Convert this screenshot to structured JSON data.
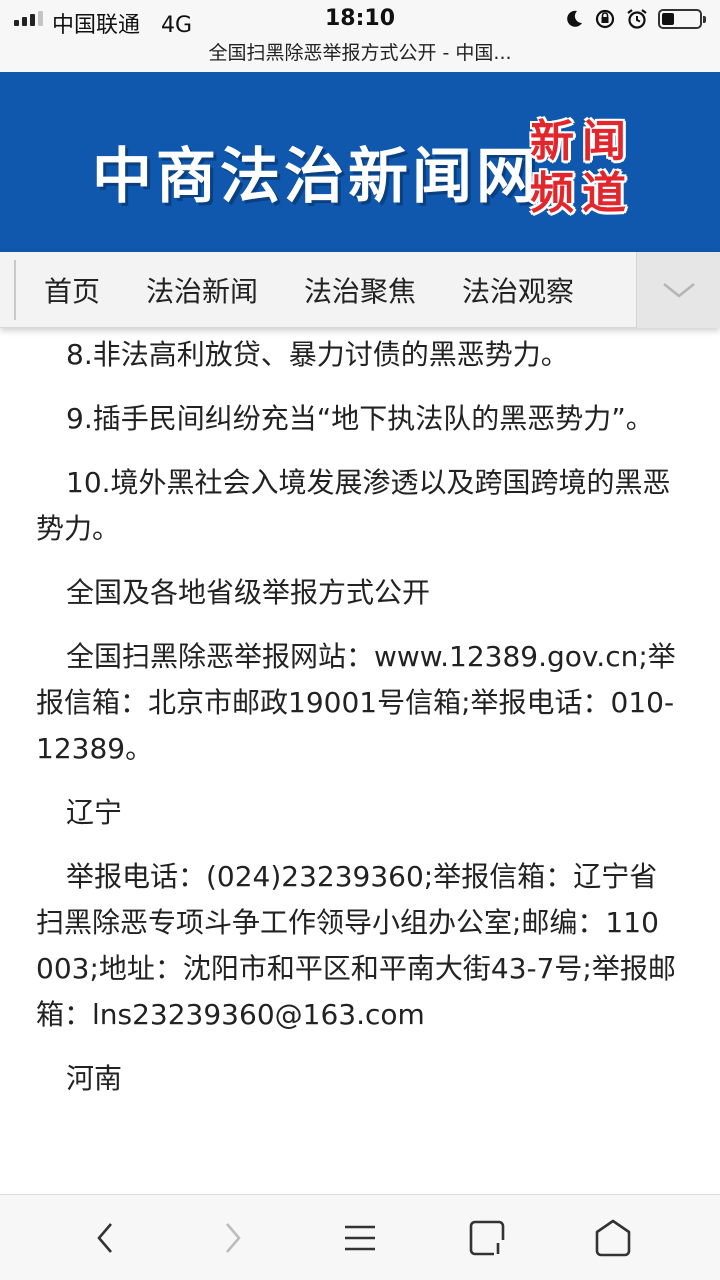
{
  "status_bar": {
    "carrier": "中国联通",
    "network": "4G",
    "time": "18:10"
  },
  "browser": {
    "page_title": "全国扫黑除恶举报方式公开 - 中国..."
  },
  "site": {
    "name": "中商法治新闻网",
    "seal_chars": [
      "新",
      "闻",
      "频",
      "道"
    ],
    "brand_color": "#0f58ad"
  },
  "nav": {
    "items": [
      {
        "label": "首页"
      },
      {
        "label": "法治新闻"
      },
      {
        "label": "法治聚焦"
      },
      {
        "label": "法治观察"
      }
    ]
  },
  "article": {
    "paragraphs": [
      "8.非法高利放贷、暴力讨债的黑恶势力。",
      "9.插手民间纠纷充当“地下执法队的黑恶势力”。",
      "10.境外黑社会入境发展渗透以及跨国跨境的黑恶势力。",
      "全国及各地省级举报方式公开",
      "全国扫黑除恶举报网站：www.12389.gov.cn;举报信箱：北京市邮政19001号信箱;举报电话：010-12389。",
      "辽宁",
      "举报电话：(024)23239360;举报信箱：辽宁省扫黑除恶专项斗争工作领导小组办公室;邮编：110003;地址：沈阳市和平区和平南大街43-7号;举报邮箱：lns23239360@163.com",
      "河南"
    ]
  },
  "toolbar": {
    "icons": [
      "back-icon",
      "forward-icon",
      "menu-icon",
      "tabs-icon",
      "home-icon"
    ]
  }
}
